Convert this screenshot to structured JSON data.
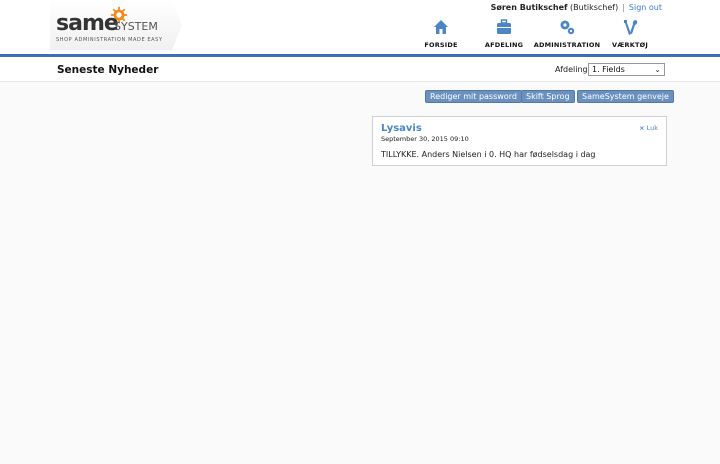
{
  "logo": {
    "same": "same",
    "system": "SYSTEM",
    "tagline": "SHOP ADMINISTRATION MADE EASY"
  },
  "userbar": {
    "user_name": "Søren Butikschef",
    "user_role": "(Butikschef)",
    "separator": "|",
    "signout": "Sign out"
  },
  "nav": [
    {
      "label": "FORSIDE",
      "icon": "home-icon"
    },
    {
      "label": "AFDELING",
      "icon": "briefcase-icon"
    },
    {
      "label": "ADMINISTRATION",
      "icon": "gears-icon"
    },
    {
      "label": "VÆRKTØJ",
      "icon": "tools-icon"
    }
  ],
  "page": {
    "title": "Seneste Nyheder",
    "dept_label": "Afdeling",
    "dept_selected": "1. Fields"
  },
  "buttons": {
    "password": "Rediger mit password",
    "language": "Skift Sprog",
    "shortcuts": "SameSystem genveje"
  },
  "news": {
    "title": "Lysavis",
    "date": "September 30, 2015 09:10",
    "close_label": "Luk",
    "close_symbol": "×",
    "body": "TILLYKKE. Anders Nielsen i 0. HQ har fødselsdag i dag"
  },
  "colors": {
    "accent": "#3d6fb4",
    "button": "#6a90bf",
    "link": "#4a86c8"
  }
}
